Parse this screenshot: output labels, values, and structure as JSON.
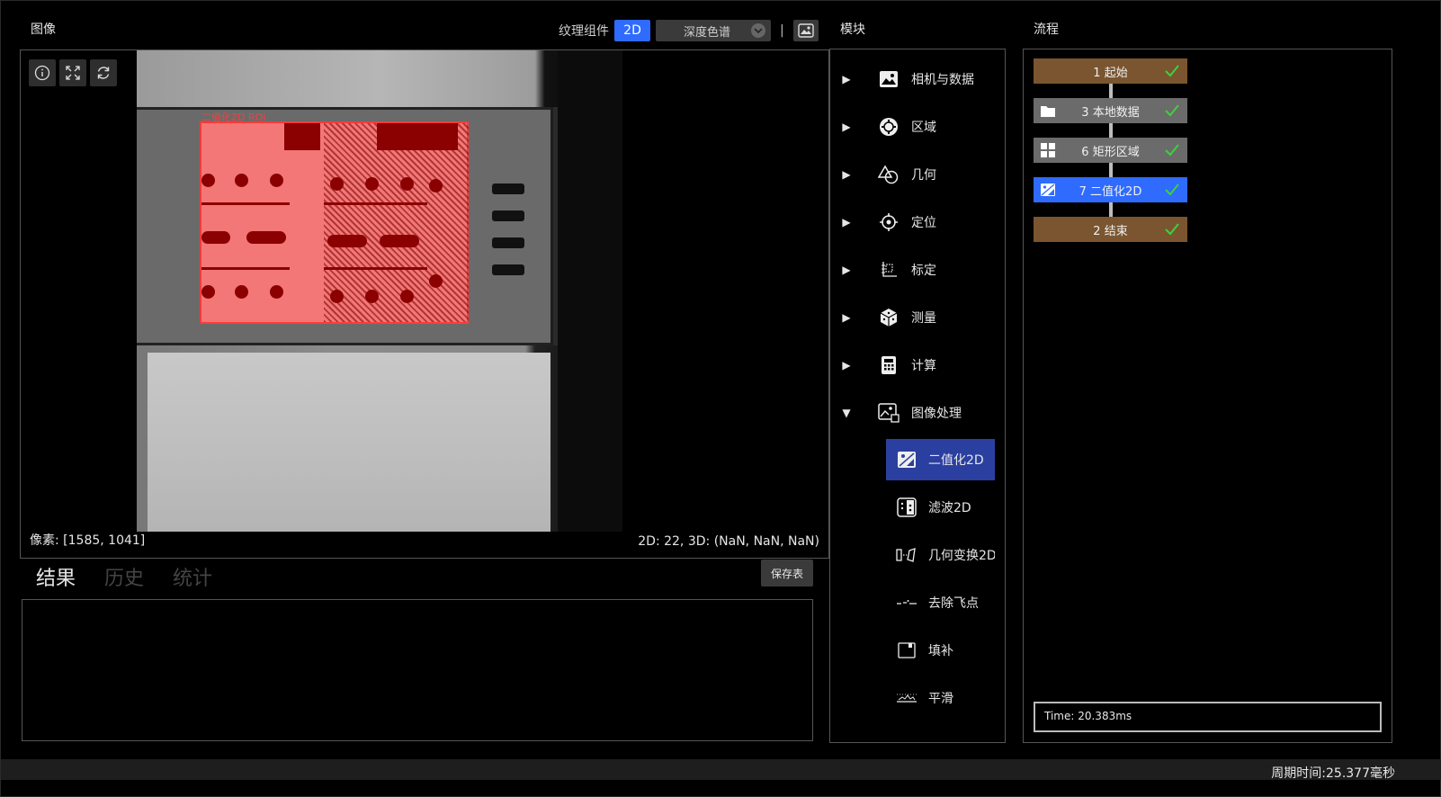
{
  "sections": {
    "image_title": "图像",
    "modules_title": "模块",
    "flow_title": "流程"
  },
  "toolbar": {
    "texture_label": "纹理组件",
    "mode_2d": "2D",
    "colormap": "深度色谱",
    "separator": "|"
  },
  "viewer": {
    "pixel_status": "像素: [1585, 1041]",
    "value_status": "2D: 22, 3D: (NaN, NaN, NaN)",
    "overlay_label": "二值化2D ROI",
    "overlay_color": "#ff3b3b"
  },
  "results": {
    "tabs": [
      {
        "label": "结果",
        "active": true
      },
      {
        "label": "历史",
        "active": false
      },
      {
        "label": "统计",
        "active": false
      }
    ],
    "save_label": "保存表"
  },
  "modules": {
    "items": [
      {
        "label": "相机与数据",
        "icon": "image-icon",
        "expanded": false
      },
      {
        "label": "区域",
        "icon": "region-icon",
        "expanded": false
      },
      {
        "label": "几何",
        "icon": "geometry-icon",
        "expanded": false
      },
      {
        "label": "定位",
        "icon": "crosshair-icon",
        "expanded": false
      },
      {
        "label": "标定",
        "icon": "calibration-icon",
        "expanded": false
      },
      {
        "label": "测量",
        "icon": "cube-icon",
        "expanded": false
      },
      {
        "label": "计算",
        "icon": "calculator-icon",
        "expanded": false
      },
      {
        "label": "图像处理",
        "icon": "image-process-icon",
        "expanded": true
      }
    ],
    "sub_items": [
      {
        "label": "二值化2D",
        "icon": "binarize-icon",
        "active": true
      },
      {
        "label": "滤波2D",
        "icon": "filter-icon",
        "active": false
      },
      {
        "label": "几何变换2D",
        "icon": "transform-icon",
        "active": false
      },
      {
        "label": "去除飞点",
        "icon": "remove-outliers-icon",
        "active": false
      },
      {
        "label": "填补",
        "icon": "fill-icon",
        "active": false
      },
      {
        "label": "平滑",
        "icon": "smooth-icon",
        "active": false
      }
    ],
    "arrow_collapsed": "▶",
    "arrow_expanded": "▼"
  },
  "flow": {
    "nodes": [
      {
        "label": "1 起始",
        "color": "#7a5530",
        "icon": ""
      },
      {
        "label": "3 本地数据",
        "color": "#6b6b6b",
        "icon": "folder-icon"
      },
      {
        "label": "6 矩形区域",
        "color": "#6b6b6b",
        "icon": "grid-icon"
      },
      {
        "label": "7 二值化2D",
        "color": "#2f6bff",
        "icon": "binarize-icon"
      },
      {
        "label": "2 结束",
        "color": "#7a5530",
        "icon": ""
      }
    ],
    "check_color": "#3cd23c",
    "time": "Time: 20.383ms"
  },
  "footer": {
    "cycle_time": "周期时间:25.377毫秒"
  }
}
